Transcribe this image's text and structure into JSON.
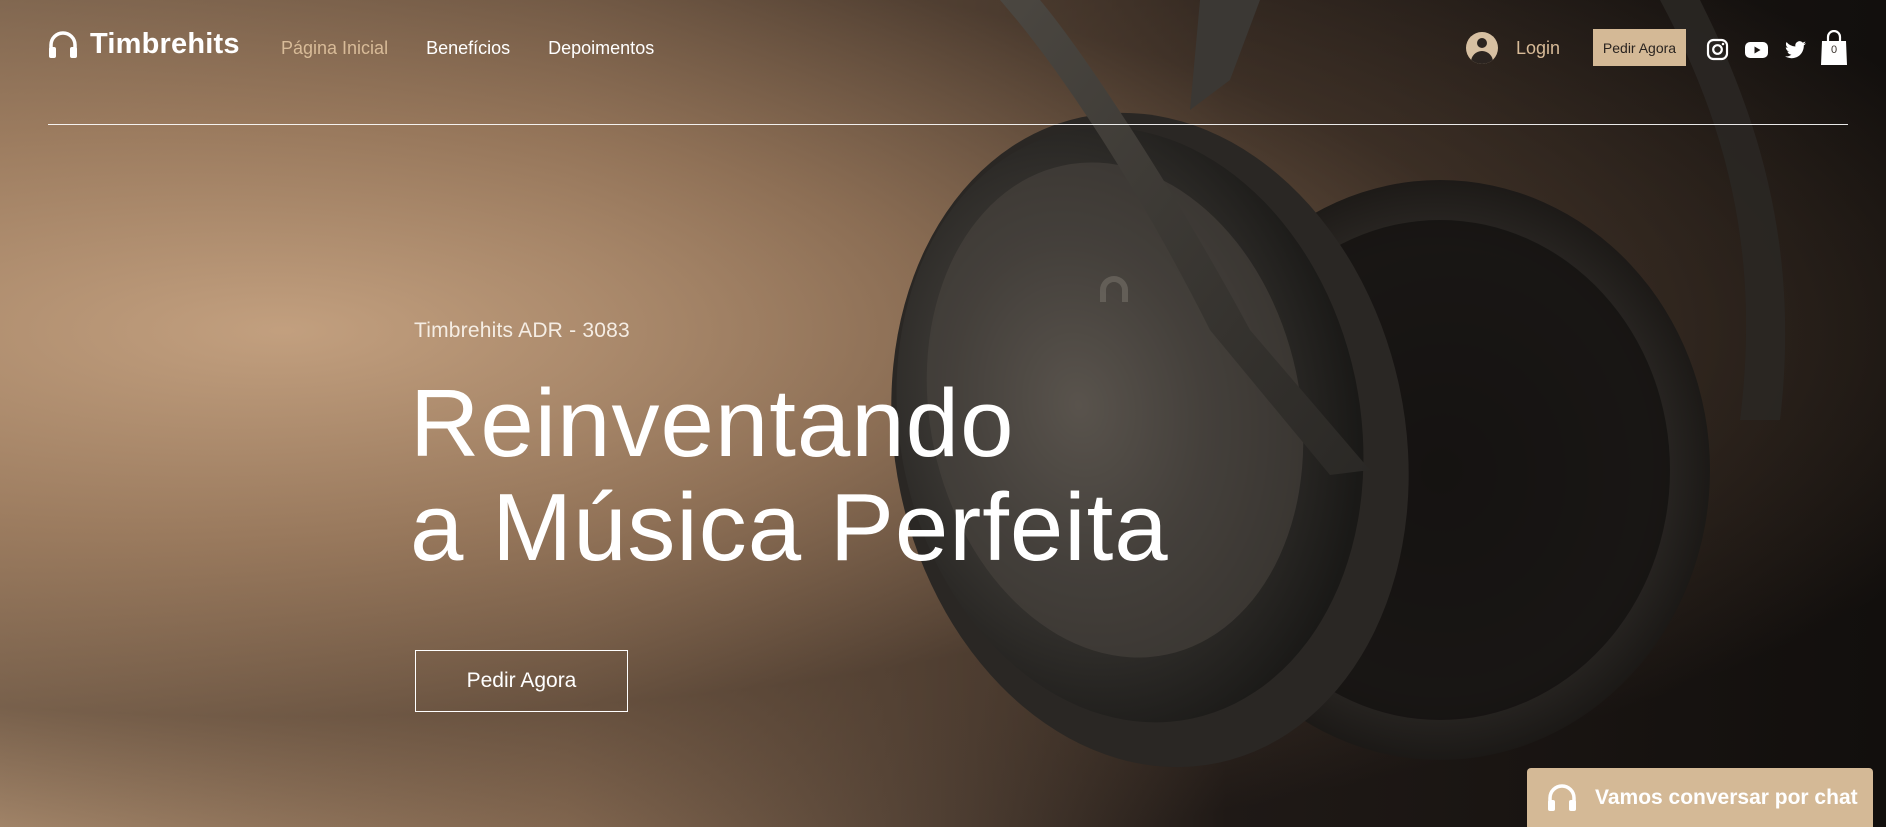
{
  "brand": {
    "name": "Timbrehits",
    "logo_icon": "headphones-icon"
  },
  "nav": {
    "items": [
      {
        "label": "Página Inicial",
        "active": true
      },
      {
        "label": "Benefícios",
        "active": false
      },
      {
        "label": "Depoimentos",
        "active": false
      }
    ]
  },
  "header": {
    "login_label": "Login",
    "order_label": "Pedir Agora",
    "social": [
      "instagram-icon",
      "youtube-icon",
      "twitter-icon"
    ],
    "cart_count": "0"
  },
  "hero": {
    "subtitle": "Timbrehits ADR - 3083",
    "title_line1": "Reinventando",
    "title_line2": "a Música Perfeita",
    "cta_label": "Pedir Agora"
  },
  "chat": {
    "label": "Vamos conversar por chat",
    "icon": "headphones-icon"
  },
  "colors": {
    "accent": "#d4b996",
    "nav_active": "#d8bb98",
    "text": "#ffffff"
  }
}
